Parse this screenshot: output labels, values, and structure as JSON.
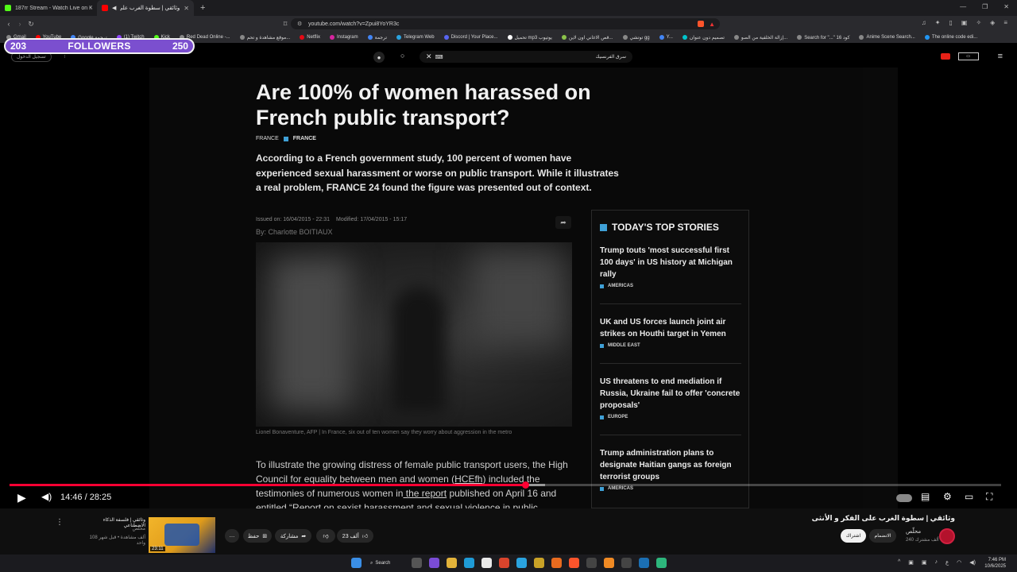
{
  "browser": {
    "tabs": [
      {
        "title": "187rr Stream - Watch Live on Kick",
        "favicon_color": "#53fc18"
      },
      {
        "title": "وثائقي | سطوة الغرب على الذ...",
        "favicon_color": "#ff0000"
      }
    ],
    "url": "youtube.com/watch?v=Zpui8YoYR3c",
    "bookmarks": [
      "Gmail",
      "YouTube",
      "Google ترجمة",
      "(1) Twitch",
      "Kick",
      "Red Dead Online -...",
      "موقع مشاهدة و تحم...",
      "Netflix",
      "Instagram",
      "ترجمة",
      "Telegram Web",
      "Discord | Your Place...",
      "تحميل mp3 يوتيوب",
      "قص الاغاني اون لاين...",
      "توتشي gg",
      "Y...",
      "تصميم دون عنوان",
      "إزالة الخلفية من الصو...",
      "Search for \"...\" 16 كود",
      "Anime Scene Search...",
      "The online code edi..."
    ]
  },
  "overlay": {
    "current": "203",
    "label": "FOLLOWERS",
    "goal": "250"
  },
  "youtube": {
    "search_text": "سرق الفرنسيك",
    "left_label": "تسجيل الدخول"
  },
  "article": {
    "title": "Are 100% of women harassed on French public transport?",
    "crumb1": "FRANCE",
    "crumb2": "FRANCE",
    "lede": "According to a French government study, 100 percent of women have experienced sexual harassment or worse on public transport. While it illustrates a real problem, FRANCE 24 found the figure was presented out of context.",
    "issued": "Issued on: 16/04/2015 - 22:31",
    "modified": "Modified: 17/04/2015 - 15:17",
    "byline": "By: Charlotte BOITIAUX",
    "caption": "Lionel Bonaventure, AFP | In France, six out of ten women say they worry about aggression in the metro",
    "body_1": "To illustrate the growing distress of female public transport users, the High Council for equality between men and women (",
    "body_link1": "HCEfh",
    "body_2": ") included the testimonies of numerous women in",
    "body_link2": " the report",
    "body_3": " published on April 16 and entitled “Report on sexist harassment and sexual violence in public"
  },
  "top_stories": {
    "heading": "TODAY'S TOP STORIES",
    "items": [
      {
        "title": "Trump touts 'most successful first 100 days' in US history at Michigan rally",
        "tag": "AMERICAS"
      },
      {
        "title": "UK and US forces launch joint air strikes on Houthi target in Yemen",
        "tag": "MIDDLE EAST"
      },
      {
        "title": "US threatens to end mediation if Russia, Ukraine fail to offer 'concrete proposals'",
        "tag": "EUROPE"
      },
      {
        "title": "Trump administration plans to designate Haitian gangs as foreign terrorist groups",
        "tag": "AMERICAS"
      }
    ]
  },
  "player": {
    "time": "14:46 / 28:25",
    "progress": 0.52
  },
  "video": {
    "title": "وثائقي | سطوة الغرب على الفكر و الأنثى",
    "channel": "محلّص",
    "subs": "240 ألف مشترك",
    "subscribe": "اشتراك",
    "join": "الانضمام",
    "likes": "23 ألف",
    "share": "مشاركة",
    "save": "حفظ"
  },
  "related": {
    "title": "وثائقي | فلسفة الذكاء الاصطناعي",
    "channel": "محلّص",
    "views": "108 ألف مشاهدة • قبل شهر واحد",
    "duration": "23:11"
  },
  "taskbar": {
    "search": "Search",
    "time": "7:46 PM",
    "date": "10/6/2025"
  }
}
